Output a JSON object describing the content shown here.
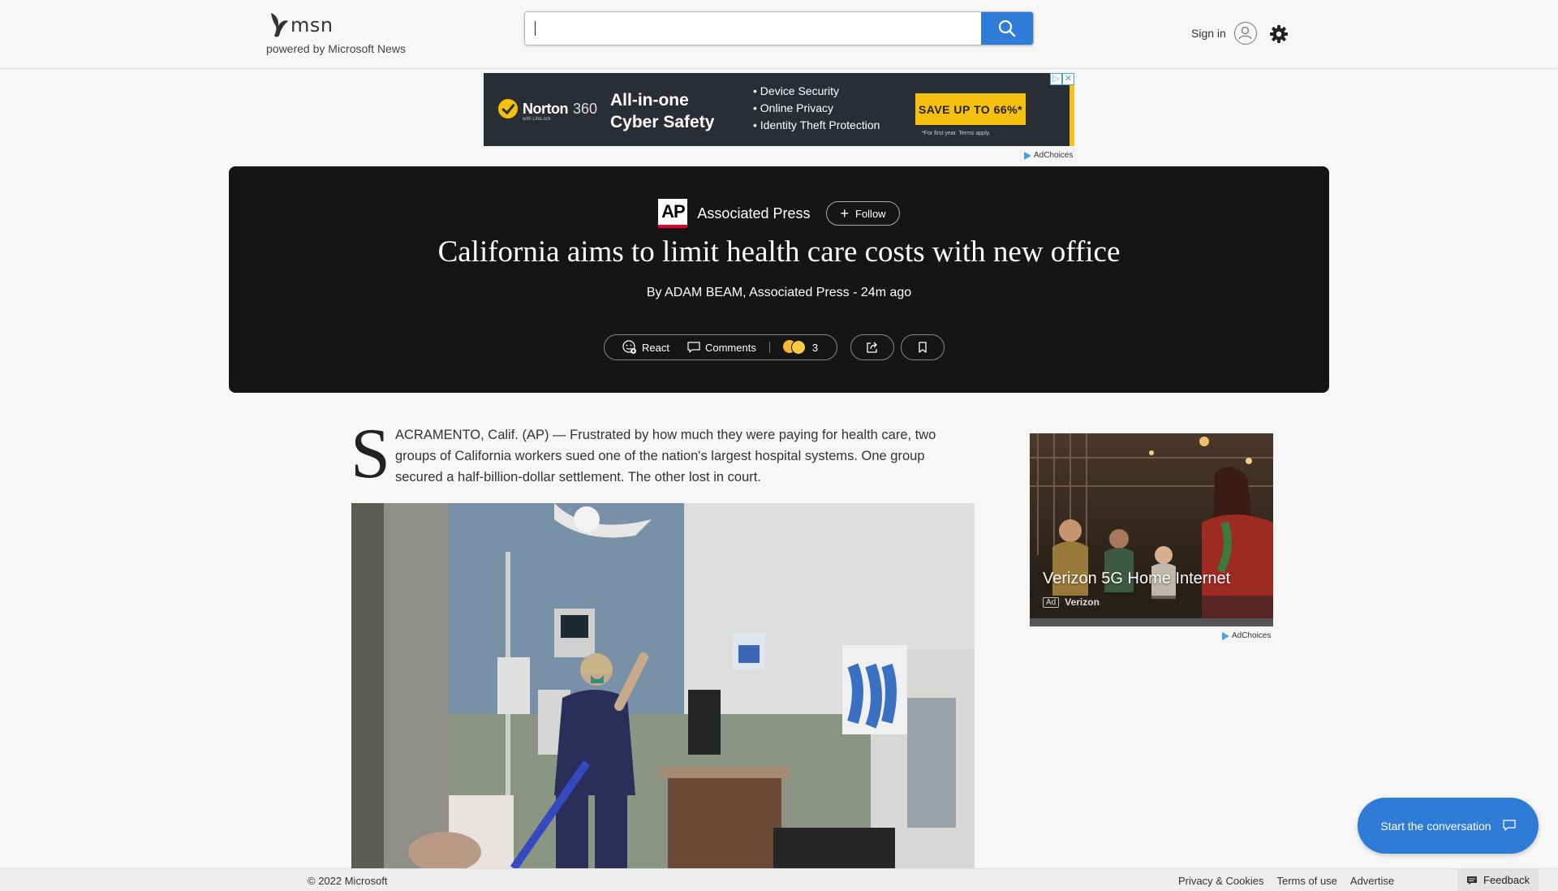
{
  "header": {
    "logo_text": "msn",
    "powered_by": "powered by Microsoft News",
    "search_value": "",
    "signin_label": "Sign in"
  },
  "top_ad": {
    "brand": "Norton",
    "brand_suffix": "360",
    "brand_sub": "with LifeLock",
    "headline": "All-in-one Cyber Safety",
    "bullets": [
      "• Device Security",
      "• Online Privacy",
      "• Identity Theft Protection"
    ],
    "cta": "SAVE UP TO 66%*",
    "terms": "*For first year. Terms apply.",
    "adchoices": "AdChoices"
  },
  "article": {
    "source_logo": "AP",
    "source": "Associated Press",
    "follow_label": "Follow",
    "title": "California aims to limit health care costs with new office",
    "byline": "By ADAM BEAM, Associated Press - 24m ago",
    "react_label": "React",
    "comments_label": "Comments",
    "reaction_count": "3",
    "dropcap": "S",
    "lede": "ACRAMENTO, Calif. (AP) — Frustrated by how much they were paying for health care, two groups of California workers sued one of the nation's largest hospital systems. One group secured a half-billion-dollar settlement. The other lost in court."
  },
  "right_ad": {
    "title": "Verizon 5G Home Internet",
    "badge": "Ad",
    "advertiser": "Verizon",
    "adchoices": "AdChoices"
  },
  "chat": {
    "label": "Start the conversation"
  },
  "footer": {
    "copyright": "© 2022 Microsoft",
    "links": [
      "Privacy & Cookies",
      "Terms of use",
      "Advertise"
    ],
    "feedback": "Feedback"
  },
  "colors": {
    "accent": "#2f7bd8",
    "hero_bg": "#151515",
    "norton_yellow": "#f5c010"
  }
}
